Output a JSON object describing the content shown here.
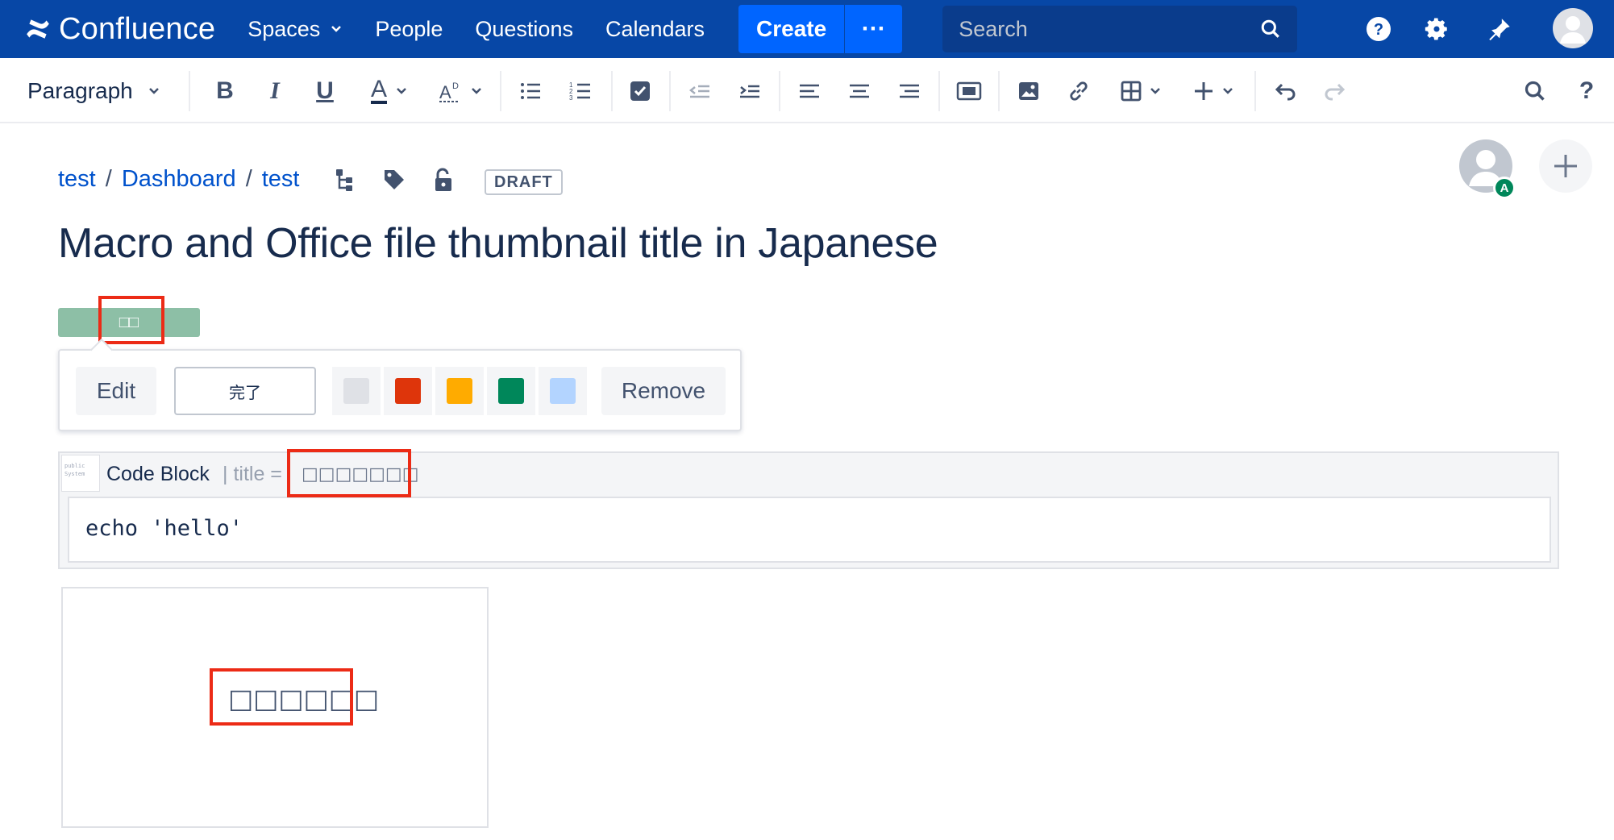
{
  "nav": {
    "logo_text": "Confluence",
    "items": [
      {
        "label": "Spaces"
      },
      {
        "label": "People"
      },
      {
        "label": "Questions"
      },
      {
        "label": "Calendars"
      }
    ],
    "create_label": "Create",
    "more_label": "···",
    "search_placeholder": "Search",
    "icons": [
      "help-icon",
      "settings-icon",
      "notifications-icon",
      "profile-avatar"
    ]
  },
  "toolbar": {
    "paragraph_label": "Paragraph",
    "buttons": [
      "bold",
      "italic",
      "underline",
      "text-color",
      "text-style",
      "bullet-list",
      "numbered-list",
      "task-list",
      "outdent",
      "indent",
      "align-left",
      "align-center",
      "align-right",
      "page-layout",
      "image",
      "link",
      "table",
      "insert-more",
      "undo",
      "redo",
      "find-replace",
      "help"
    ],
    "icons": {
      "bold": "B",
      "italic": "I",
      "underline": "U",
      "text_color": "A",
      "help": "?"
    }
  },
  "breadcrumb": {
    "items": [
      "test",
      "Dashboard",
      "test"
    ],
    "separator": "/",
    "draft_label": "DRAFT"
  },
  "collaborator": {
    "badge": "A"
  },
  "page": {
    "title": "Macro and Office file thumbnail title in Japanese"
  },
  "status": {
    "lozenge_text": "□□",
    "popup": {
      "edit_label": "Edit",
      "input_value": "完了",
      "remove_label": "Remove",
      "colors": [
        "#dfe1e6",
        "#de350b",
        "#ffab00",
        "#00875a",
        "#b3d4ff"
      ]
    }
  },
  "code_macro": {
    "name": "Code Block",
    "param": "| title =",
    "title_value": "□□□□□□□",
    "code": "echo 'hello'",
    "icon_text": "public\nSystem"
  },
  "thumbnail": {
    "title": "□□□□□□"
  },
  "annotation_color": "#ec2b16"
}
